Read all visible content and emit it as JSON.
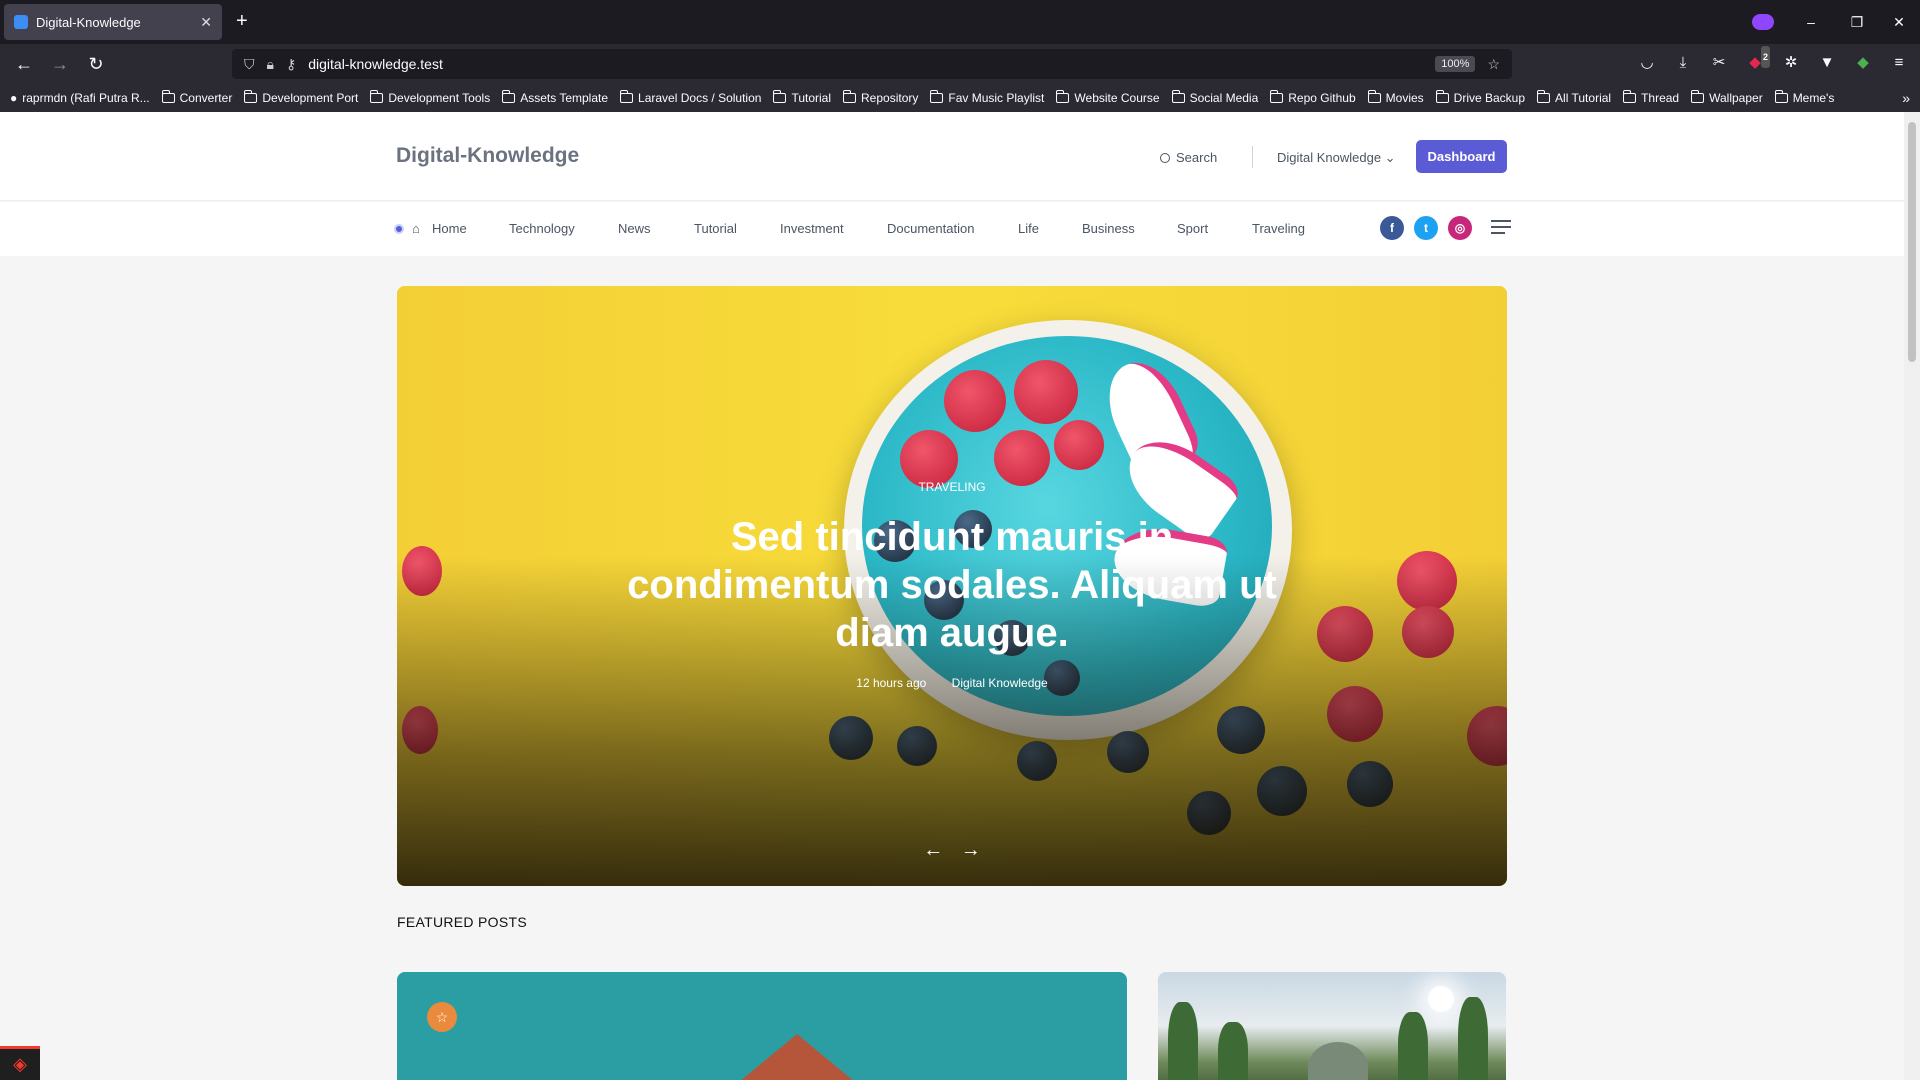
{
  "browser": {
    "tab_title": "Digital-Knowledge",
    "tab_close": "✕",
    "new_tab": "+",
    "url": "digital-knowledge.test",
    "zoom": "100%",
    "window_controls": {
      "minimize": "–",
      "restore": "❐",
      "close": "✕"
    },
    "nav": {
      "back": "←",
      "forward": "→",
      "reload": "↻"
    },
    "bookmarks": [
      "raprmdn (Rafi Putra R...",
      "Converter",
      "Development Port",
      "Development Tools",
      "Assets Template",
      "Laravel Docs / Solution",
      "Tutorial",
      "Repository",
      "Fav Music Playlist",
      "Website Course",
      "Social Media",
      "Repo Github",
      "Movies",
      "Drive Backup",
      "All Tutorial",
      "Thread",
      "Wallpaper",
      "Meme's"
    ],
    "more_bookmarks": "»",
    "extension_badge": "2"
  },
  "site": {
    "logo": "Digital-Knowledge",
    "search": "Search",
    "user": "Digital Knowledge ⌄",
    "dashboard": "Dashboard",
    "menu": [
      "Home",
      "Technology",
      "News",
      "Tutorial",
      "Investment",
      "Documentation",
      "Life",
      "Business",
      "Sport",
      "Traveling"
    ],
    "social": {
      "facebook": "f",
      "twitter": "t",
      "instagram": "◎"
    },
    "accent_color": "#5b5bd6"
  },
  "hero": {
    "category": "TRAVELING",
    "title": "Sed tincidunt mauris in condimentum sodales. Aliquam ut diam augue.",
    "time": "12 hours ago",
    "author": "Digital Knowledge",
    "prev": "←",
    "next": "→"
  },
  "featured": {
    "heading": "FEATURED POSTS",
    "badge_icon": "☆"
  }
}
